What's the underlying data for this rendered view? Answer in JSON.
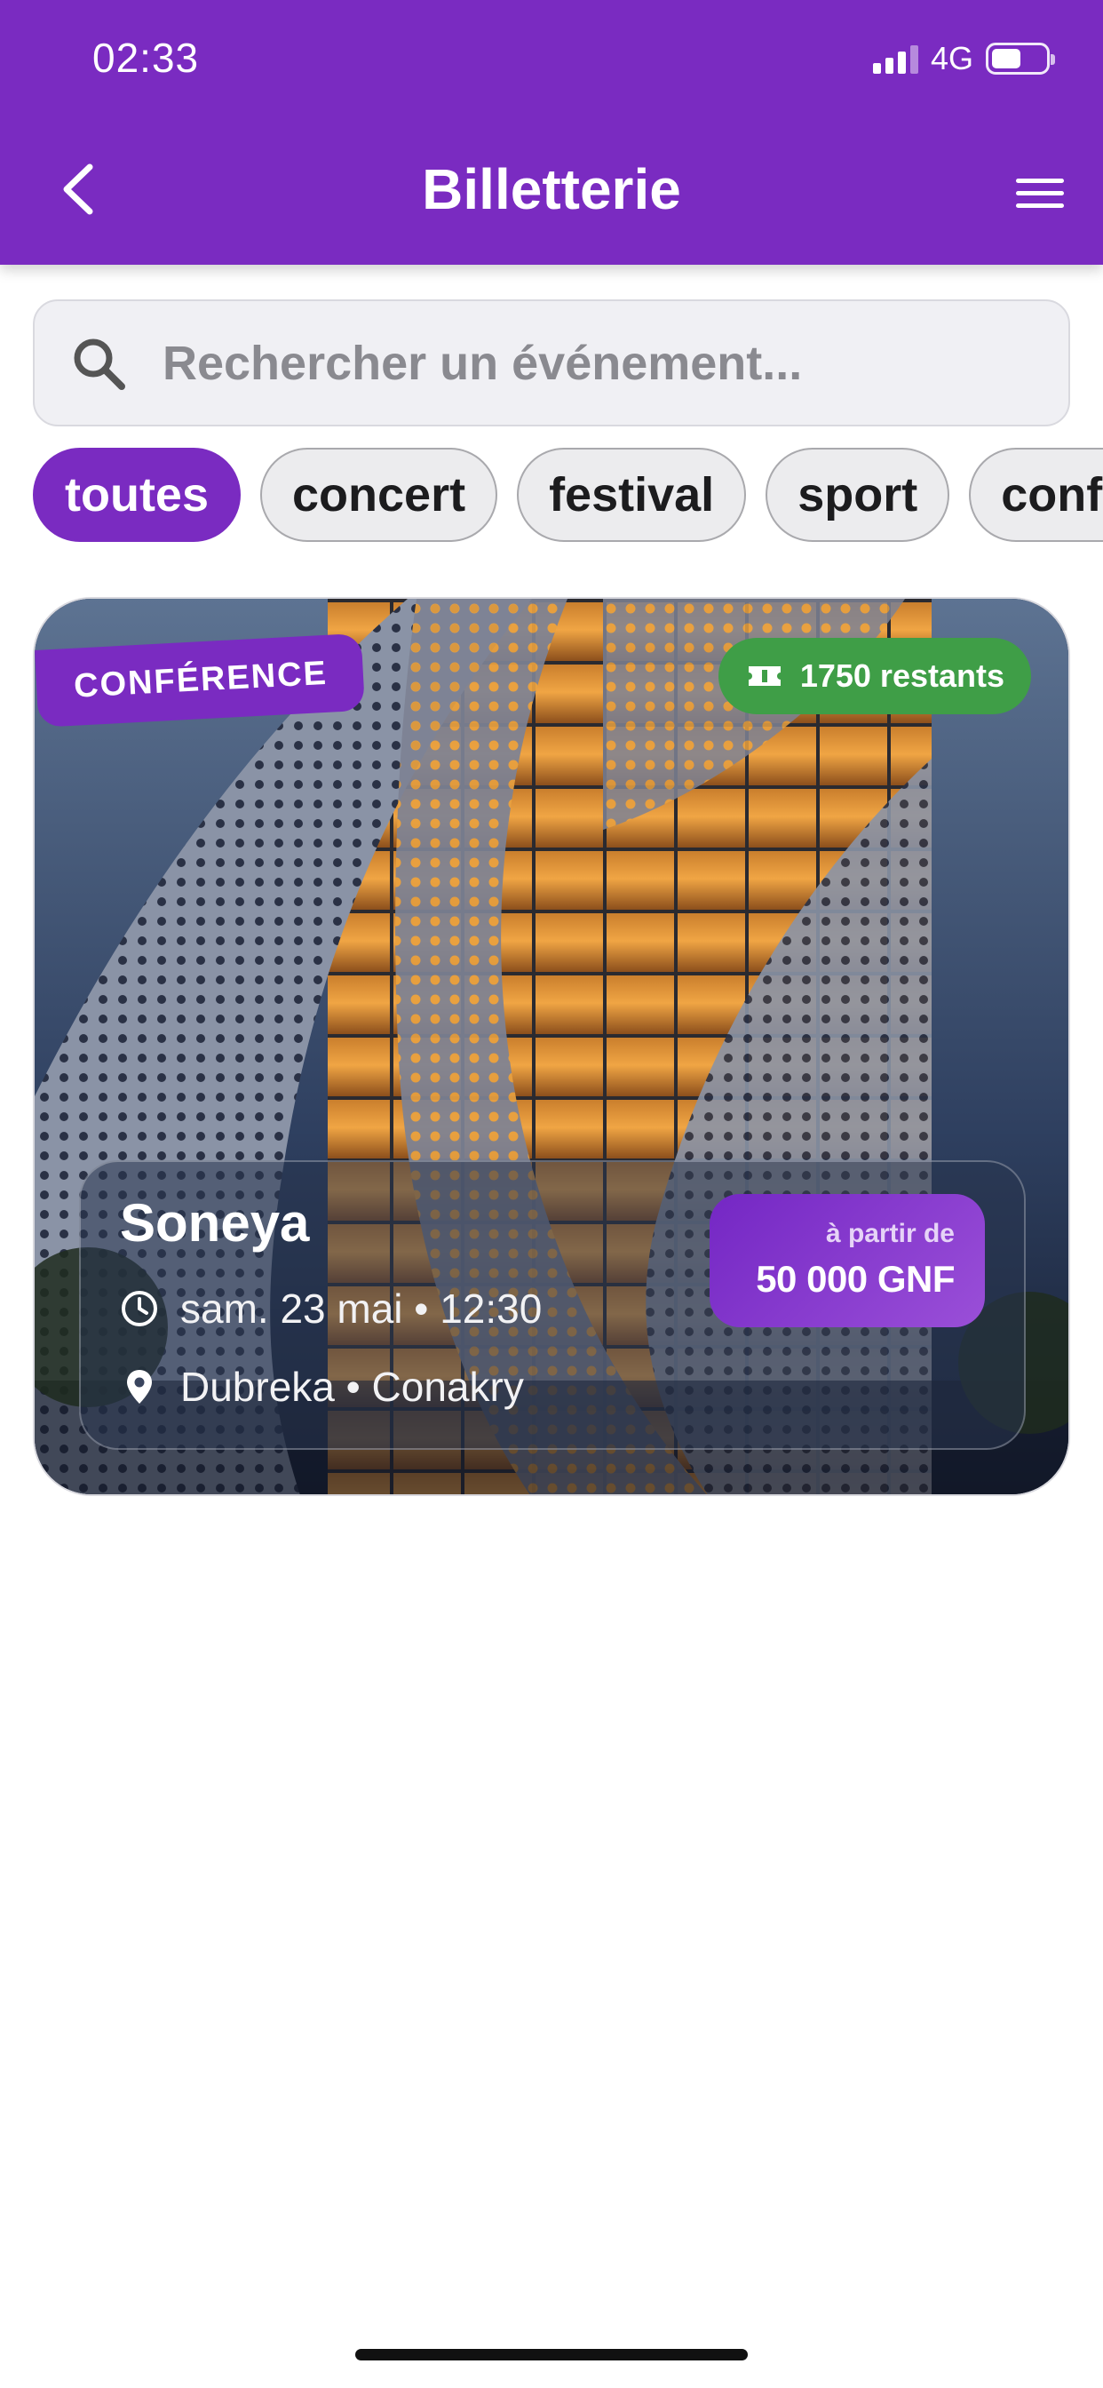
{
  "status_bar": {
    "time": "02:33",
    "network": "4G",
    "battery_level": 0.55
  },
  "header": {
    "title": "Billetterie",
    "back_icon": "chevron-left-icon",
    "menu_icon": "hamburger-menu-icon",
    "background_color": "#7a2bc1"
  },
  "search": {
    "placeholder": "Rechercher un événement...",
    "value": "",
    "icon": "search-icon"
  },
  "filters": {
    "selected": "toutes",
    "items": [
      {
        "label": "toutes"
      },
      {
        "label": "concert"
      },
      {
        "label": "festival"
      },
      {
        "label": "sport"
      },
      {
        "label": "conférence"
      }
    ]
  },
  "events": [
    {
      "category": "CONFÉRENCE",
      "remaining": "1750 restants",
      "name": "Soneya",
      "datetime": "sam. 23 mai • 12:30",
      "location": "Dubreka • Conakry",
      "price_caption": "à partir de",
      "price": "50 000 GNF",
      "image": "building-facade-photo"
    }
  ],
  "colors": {
    "accent": "#7a2bc1",
    "remaining_badge": "#3f9e47"
  }
}
